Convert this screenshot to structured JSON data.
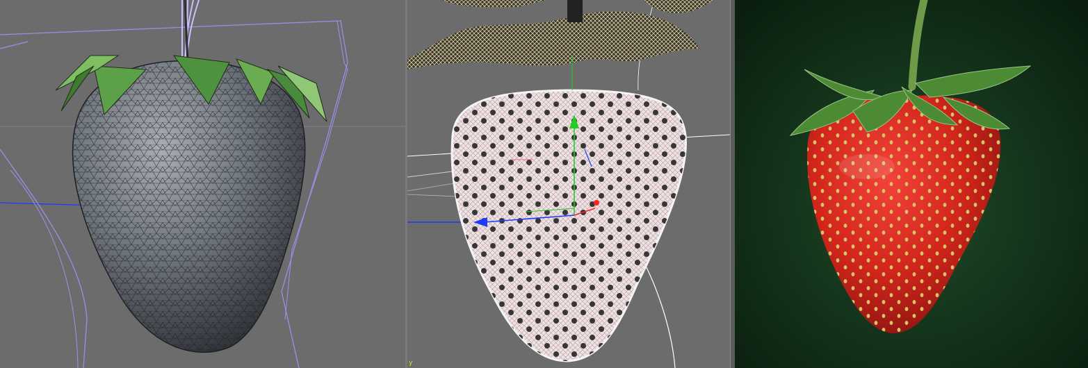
{
  "viewports": {
    "left": {
      "content": "strawberry-wireframe-low-poly"
    },
    "middle": {
      "content": "strawberry-dense-wireframe-with-gizmo",
      "axis_label": "y"
    },
    "right": {
      "content": "strawberry-final-render"
    }
  },
  "colors": {
    "viewport_bg": "#6c6c6c",
    "render_bg": "#0f2a14",
    "curve_lilac": "#9a8fe6",
    "axis_blue": "#1a3cff",
    "axis_green": "#22cc22",
    "axis_red": "#ff2222",
    "strawberry_red": "#d8261c",
    "leaf_green": "#4c8a34",
    "seed_yellow": "#d8c36a"
  }
}
